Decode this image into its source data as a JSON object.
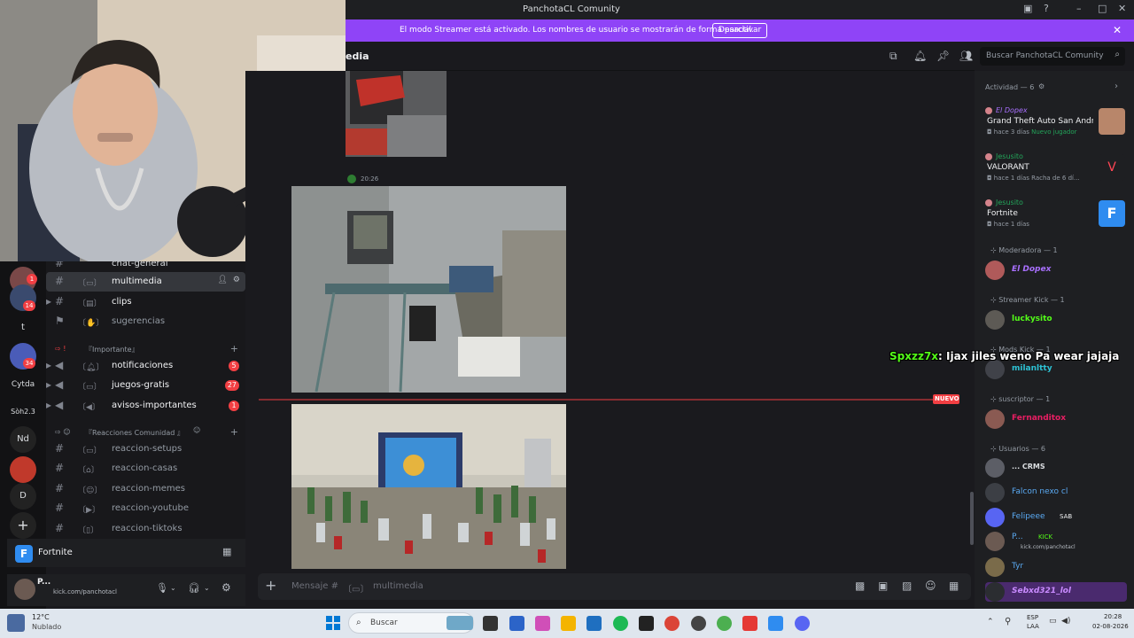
{
  "window": {
    "title": "PanchotaCL Comunity"
  },
  "banner": {
    "message": "El modo Streamer está activado. Los nombres de usuario se mostrarán de forma parcial.",
    "button": "Desactivar"
  },
  "header": {
    "channel_name": "edia",
    "search_placeholder": "Buscar PanchotaCL Comunity"
  },
  "servers": {
    "badges": [
      "1",
      "14",
      "34"
    ],
    "labels": [
      "t",
      "Cytda",
      "Sòh2.3",
      "Nd",
      "D"
    ]
  },
  "channels": {
    "partial_top": "chat-general",
    "items": [
      {
        "name": "multimedia",
        "active": true
      },
      {
        "name": "clips"
      },
      {
        "name": "sugerencias"
      }
    ],
    "category_importante": "『Importante』",
    "items2": [
      {
        "name": "notificaciones",
        "badge": "5"
      },
      {
        "name": "juegos-gratis",
        "badge": "27"
      },
      {
        "name": "avisos-importantes",
        "badge": "1"
      }
    ],
    "category_reacciones": "『Reacciones Comunidad 』",
    "items3": [
      {
        "name": "reaccion-setups"
      },
      {
        "name": "reaccion-casas"
      },
      {
        "name": "reaccion-memes"
      },
      {
        "name": "reaccion-youtube"
      },
      {
        "name": "reaccion-tiktoks"
      }
    ]
  },
  "activity_status": {
    "game": "Fortnite"
  },
  "user_panel": {
    "name": "P...",
    "status": "kick.com/panchotacl"
  },
  "chat": {
    "timestamp": "20:26",
    "new_label": "NUEVO"
  },
  "composer": {
    "placeholder": "Mensaje #",
    "channel": "multimedia"
  },
  "members": {
    "activity_header": "Actividad — 6",
    "activities": [
      {
        "user": "El Dopex",
        "game": "Grand Theft Auto San Andr...",
        "meta": "hace 3 días",
        "extra": "Nuevo jugador"
      },
      {
        "user": "Jesusito",
        "game": "VALORANT",
        "meta": "hace 1 días",
        "extra": "Racha de 6 dí..."
      },
      {
        "user": "Jesusito",
        "game": "Fortnite",
        "meta": "hace 1 días",
        "extra": ""
      }
    ],
    "groups": [
      {
        "role": "Moderadora",
        "count": "1",
        "members": [
          {
            "name": "El Dopex",
            "color": "#a970ff"
          }
        ]
      },
      {
        "role": "Streamer Kick",
        "count": "1",
        "members": [
          {
            "name": "luckysito",
            "color": "#53fc18"
          }
        ]
      },
      {
        "role": "Mods Kick",
        "count": "1",
        "members": [
          {
            "name": "milanltty",
            "color": "#2dc2d4"
          }
        ]
      },
      {
        "role": "suscriptor",
        "count": "1",
        "members": [
          {
            "name": "Fernanditox",
            "color": "#e91e63"
          }
        ]
      },
      {
        "role": "Usuarios",
        "count": "6",
        "members": [
          {
            "name": "... CRMS",
            "color": "#dbdee1"
          },
          {
            "name": "Falcon nexo cl",
            "color": "#5aa9f2"
          },
          {
            "name": "Felipeee",
            "color": "#5aa9f2",
            "tag": "SAB"
          },
          {
            "name": "P...",
            "color": "#5aa9f2",
            "tag": "KICK",
            "sub": "kick.com/panchotacl"
          },
          {
            "name": "Tyr",
            "color": "#5aa9f2"
          },
          {
            "name": "Sebxd321_lol",
            "color": "#c98bff"
          }
        ]
      }
    ]
  },
  "overlay": {
    "user": "Spxzz7x",
    "text": ": Ijax jiles weno Pa wear jajaja"
  },
  "taskbar": {
    "temp": "12°C",
    "weather": "Nublado",
    "search_placeholder": "Buscar",
    "lang": "ESP",
    "lang2": "LAA",
    "time": "20:28",
    "date": "02-08-2026"
  },
  "colors": {
    "banner": "#8f44f7",
    "accent": "#5865f2",
    "kick_green": "#53fc18",
    "new_red": "#f23f43"
  }
}
